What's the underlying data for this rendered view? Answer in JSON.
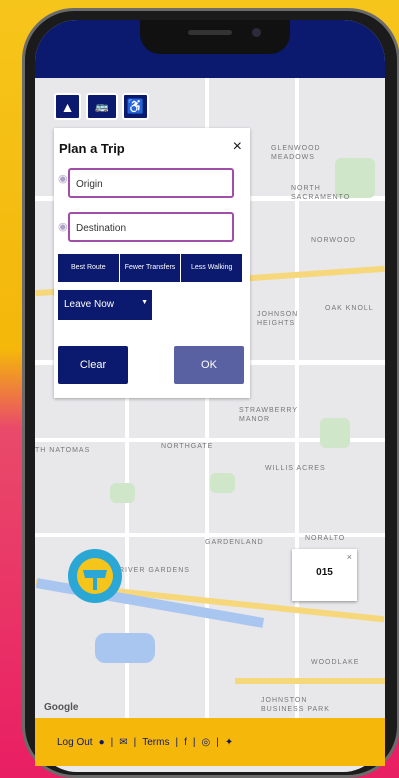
{
  "topbar": {
    "back_icon": "back-arrow-icon",
    "home_icon": "home-icon"
  },
  "modes": [
    {
      "name": "road-mode-button",
      "icon": "road-icon",
      "glyph": "▲"
    },
    {
      "name": "bus-mode-button",
      "icon": "bus-icon",
      "glyph": "🚌"
    },
    {
      "name": "walk-mode-button",
      "icon": "walk-icon",
      "glyph": "♿"
    }
  ],
  "panel": {
    "title": "Plan a Trip",
    "close": "×",
    "origin_placeholder": "Origin",
    "destination_placeholder": "Destination",
    "options": [
      "Best Route",
      "Fewer Transfers",
      "Less Walking"
    ],
    "leave_select": "Leave Now",
    "clear_label": "Clear",
    "ok_label": "OK"
  },
  "map": {
    "labels": {
      "glenwood": "GLENWOOD\nMEADOWS",
      "north_sacramento": "NORTH\nSACRAMENTO",
      "norwood": "NORWOOD",
      "oak_knoll": "OAK KNOLL",
      "johnson_heights": "JOHNSON\nHEIGHTS",
      "strawberry_manor": "STRAWBERRY\nMANOR",
      "northgate": "NORTHGATE",
      "natomas": "TH NATOMAS",
      "willis_acres": "WILLIS ACRES",
      "gardenland": "GARDENLAND",
      "noralto": "NORALTO",
      "river_gardens": "RIVER GARDENS",
      "woodlake": "WOODLAKE",
      "johnston": "JOHNSTON\nBUSINESS PARK"
    },
    "popup_number": "015",
    "popup_close": "×",
    "google": "Google"
  },
  "footer": {
    "logout": "Log Out",
    "terms": "Terms",
    "sep": "|"
  },
  "colors": {
    "navy": "#0b1a6e",
    "yellow": "#f4b70a",
    "pink": "#e91e63"
  }
}
